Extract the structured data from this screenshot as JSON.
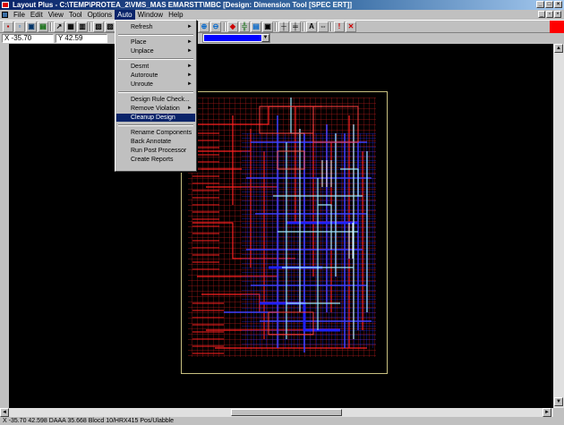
{
  "title": "Layout Plus - C:\\TEMP\\PROTEA_2\\VMS_MAS EMARSTT\\MBC [Design: Dimension Tool [SPEC ERT]]",
  "menu": {
    "items": [
      "File",
      "Edit",
      "View",
      "Tool",
      "Options",
      "Auto",
      "Window",
      "Help"
    ],
    "active_index": 5
  },
  "coords": {
    "x": "X  -35.70",
    "y": "Y  42.59"
  },
  "auto_menu": {
    "items": [
      {
        "label": "Refresh",
        "submenu": true
      },
      {
        "label": "Place",
        "submenu": true
      },
      {
        "label": "Unplace",
        "submenu": true
      },
      {
        "label": "Desmt",
        "submenu": true
      },
      {
        "label": "Autoroute",
        "submenu": true
      },
      {
        "label": "Unroute",
        "submenu": true
      },
      {
        "label": "Design Rule Check...",
        "submenu": false
      },
      {
        "label": "Remove Violation",
        "submenu": true
      },
      {
        "label": "Cleanup Design",
        "submenu": false,
        "active": true
      },
      {
        "label": "Rename Components",
        "submenu": false
      },
      {
        "label": "Back Annotate",
        "submenu": false
      },
      {
        "label": "Run Post Processor",
        "submenu": false
      },
      {
        "label": "Create Reports",
        "submenu": false
      }
    ]
  },
  "status": "X -35.70  42.598  DAAA  35.668  Blocd  10/HRX415  Pos/Ulabble",
  "colors": {
    "trace_red": "#dd2020",
    "trace_blue": "#3030ff",
    "trace_cyan": "#a0e8ff",
    "board_outline": "#c8c080",
    "active_layer": "#0000ff"
  }
}
